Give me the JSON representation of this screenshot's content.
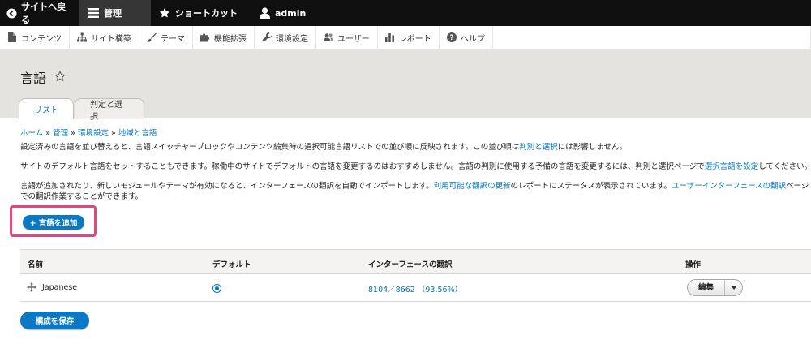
{
  "toolbar": {
    "back_label": "サイトへ戻る",
    "manage_label": "管理",
    "shortcuts_label": "ショートカット",
    "user_label": "admin"
  },
  "menu": [
    {
      "label": "コンテンツ",
      "icon": "page-icon"
    },
    {
      "label": "サイト構築",
      "icon": "structure-icon"
    },
    {
      "label": "テーマ",
      "icon": "paint-brush-icon"
    },
    {
      "label": "機能拡張",
      "icon": "puzzle-icon"
    },
    {
      "label": "環境設定",
      "icon": "wrench-icon"
    },
    {
      "label": "ユーザー",
      "icon": "users-icon"
    },
    {
      "label": "レポート",
      "icon": "bar-chart-icon"
    },
    {
      "label": "ヘルプ",
      "icon": "help-icon"
    }
  ],
  "page": {
    "title": "言語",
    "tabs": [
      {
        "label": "リスト"
      },
      {
        "label": "判定と選択"
      }
    ]
  },
  "breadcrumb": [
    {
      "label": "ホーム"
    },
    {
      "label": "管理"
    },
    {
      "label": "環境設定"
    },
    {
      "label": "地域と言語"
    }
  ],
  "breadcrumb_sep": "»",
  "text": {
    "p1_a": "設定済みの言語を並び替えると、言語スイッチャーブロックやコンテンツ編集時の選択可能言語リストでの並び順に反映されます。この並び順は",
    "p1_link": "判別と選択",
    "p1_b": "には影響しません。",
    "p2_a": "サイトのデフォルト言語をセットすることもできます。稼働中のサイトでデフォルトの言語を変更するのはおすすめしません。言語の判別に使用する予備の言語を変更するには、判別と選択ページで",
    "p2_link": "選択言語を設定",
    "p2_b": "してください。",
    "p3_a": "言語が追加されたり、新しいモジュールやテーマが有効になると、インターフェースの翻訳を自動でインポートします。",
    "p3_link1": "利用可能な翻訳の更新",
    "p3_b": "のレポートにステータスが表示されています。",
    "p3_link2": "ユーザーインターフェースの翻訳",
    "p3_c": "ページでの翻訳作業することができます。"
  },
  "actions": {
    "add_language": "+ 言語を追加",
    "save": "構成を保存"
  },
  "table": {
    "headers": {
      "name": "名前",
      "default": "デフォルト",
      "translation": "インターフェースの翻訳",
      "operations": "操作"
    },
    "rows": [
      {
        "name": "Japanese",
        "is_default": true,
        "translation": "8104／8662 （93.56%）",
        "operation": "編集"
      }
    ]
  },
  "colors": {
    "accent": "#0074bd",
    "button": "#0b78c4",
    "highlight": "#e4457d",
    "toolbar": "#0f0f0f"
  }
}
